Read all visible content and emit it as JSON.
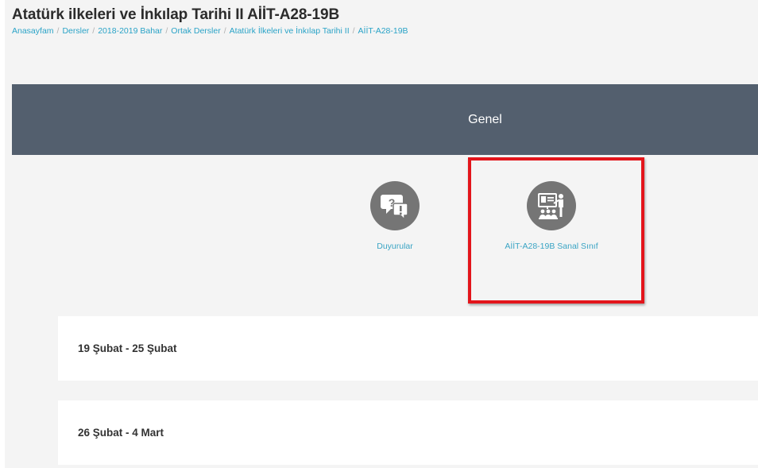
{
  "page": {
    "title": "Atatürk ilkeleri ve İnkılap Tarihi II AİİT-A28-19B",
    "breadcrumb": [
      "Anasayfam",
      "Dersler",
      "2018-2019 Bahar",
      "Ortak Dersler",
      "Atatürk İlkeleri ve İnkılap Tarihi II",
      "AİİT-A28-19B"
    ],
    "breadcrumb_separator": "/"
  },
  "section": {
    "title": "Genel"
  },
  "activities": [
    {
      "label": "Duyurular",
      "icon": "forum-question-icon"
    },
    {
      "label": "AİİT-A28-19B Sanal Sınıf",
      "icon": "virtual-classroom-icon"
    }
  ],
  "weeks": [
    {
      "title": "19 Şubat - 25 Şubat"
    },
    {
      "title": "26 Şubat - 4 Mart"
    }
  ],
  "colors": {
    "section_bar": "#535f6e",
    "link": "#2aa3c7",
    "highlight": "#e3151b",
    "icon_bg": "#757575"
  }
}
